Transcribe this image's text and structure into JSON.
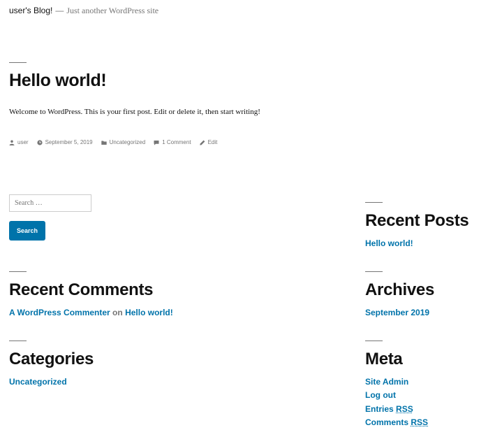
{
  "header": {
    "site_title": "user's Blog!",
    "separator": "—",
    "tagline": "Just another WordPress site"
  },
  "post": {
    "title": "Hello world!",
    "body": "Welcome to WordPress. This is your first post. Edit or delete it, then start writing!",
    "meta": {
      "author": "user",
      "date": "September 5, 2019",
      "category": "Uncategorized",
      "comments": "1 Comment",
      "edit": "Edit"
    }
  },
  "search": {
    "placeholder": "Search …",
    "button_label": "Search"
  },
  "widgets": {
    "recent_posts": {
      "title": "Recent Posts",
      "items": [
        "Hello world!"
      ]
    },
    "recent_comments": {
      "title": "Recent Comments",
      "author": "A WordPress Commenter",
      "on": "on",
      "post": "Hello world!"
    },
    "archives": {
      "title": "Archives",
      "items": [
        "September 2019"
      ]
    },
    "categories": {
      "title": "Categories",
      "items": [
        "Uncategorized"
      ]
    },
    "meta": {
      "title": "Meta",
      "site_admin": "Site Admin",
      "log_out": "Log out",
      "entries_prefix": "Entries",
      "entries_rss": "RSS",
      "comments_prefix": "Comments",
      "comments_rss": "RSS"
    }
  },
  "colors": {
    "link": "#0073aa",
    "text": "#111111",
    "muted": "#767676",
    "button": "#0073aa"
  }
}
